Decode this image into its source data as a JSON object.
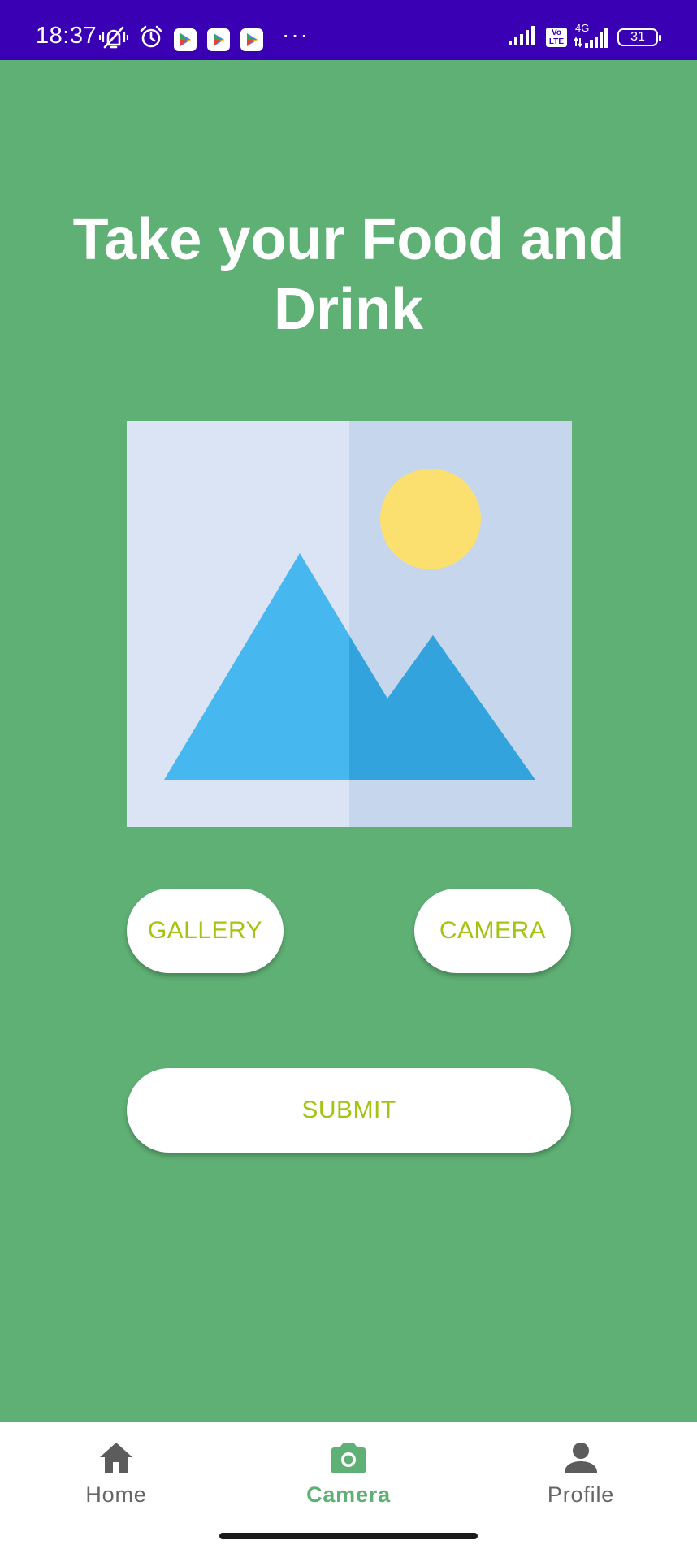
{
  "status_bar": {
    "time": "18:37",
    "network_type": "4G",
    "volte_top": "Vo",
    "volte_bottom": "LTE",
    "battery_level": "31",
    "more_indicator": "···",
    "background_color": "#3a00b4",
    "icons": [
      "vibrate-off-icon",
      "alarm-icon",
      "play-store-icon",
      "play-store-icon",
      "play-store-icon",
      "signal-icon",
      "volte-icon",
      "signal-4g-icon",
      "battery-icon"
    ]
  },
  "page": {
    "title": "Take your Food and Drink",
    "background_color": "#5fb075",
    "image_placeholder_icon": "image-placeholder-icon"
  },
  "buttons": {
    "gallery_label": "GALLERY",
    "camera_label": "CAMERA",
    "submit_label": "SUBMIT",
    "label_color": "#a3c410"
  },
  "bottom_nav": {
    "items": [
      {
        "label": "Home",
        "icon": "home-icon",
        "active": false
      },
      {
        "label": "Camera",
        "icon": "camera-icon",
        "active": true
      },
      {
        "label": "Profile",
        "icon": "person-icon",
        "active": false
      }
    ],
    "active_color": "#5fb075",
    "inactive_color": "#666666"
  }
}
